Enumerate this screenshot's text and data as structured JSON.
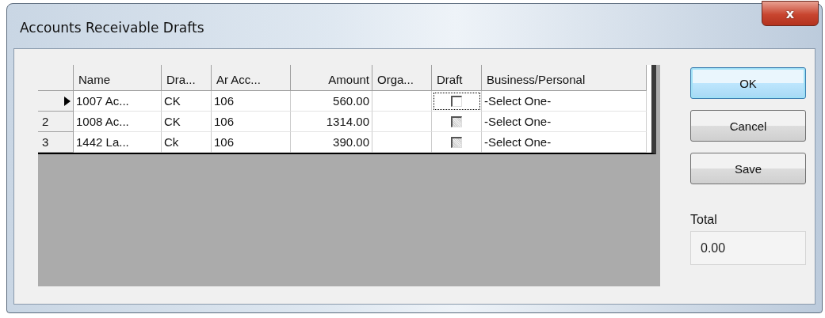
{
  "window": {
    "title": "Accounts Receivable Drafts",
    "close_button": "x"
  },
  "grid": {
    "columns": [
      "Name",
      "Dra...",
      "Ar Acc...",
      "Amount",
      "Orga...",
      "Draft",
      "Business/Personal"
    ],
    "rows": [
      {
        "selected": true,
        "cells": [
          "1007 Ac...",
          "CK",
          "106",
          "560.00"
        ],
        "draft": {
          "checked": false,
          "disabled": false
        },
        "business_personal": "-Select One-"
      },
      {
        "selected": false,
        "row_number": "2",
        "cells": [
          "1008 Ac...",
          "CK",
          "106",
          "1314.00"
        ],
        "draft": {
          "checked": false,
          "disabled": true
        },
        "business_personal": "-Select One-"
      },
      {
        "selected": false,
        "row_number": "3",
        "cells": [
          "1442 La...",
          "Ck",
          "106",
          "390.00"
        ],
        "draft": {
          "checked": false,
          "disabled": true
        },
        "business_personal": "-Select One-"
      }
    ]
  },
  "buttons": [
    {
      "label": "OK",
      "default": true
    },
    {
      "label": "Cancel",
      "default": false
    },
    {
      "label": "Save",
      "default": false
    }
  ],
  "total": {
    "label": "Total",
    "value": "0.00"
  }
}
